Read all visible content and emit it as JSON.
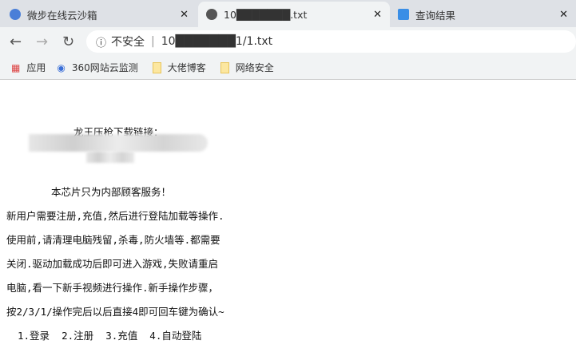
{
  "tabs": [
    {
      "title": "微步在线云沙箱",
      "icon": "weibu-logo-icon"
    },
    {
      "title": "10███████.txt",
      "icon": "globe-icon",
      "active": true
    },
    {
      "title": "查询结果",
      "icon": "x-logo-icon"
    }
  ],
  "toolbar": {
    "security_label": "不安全",
    "url": "10███████1/1.txt"
  },
  "bookmarks": [
    {
      "label": "应用",
      "icon": "apps-grid-icon"
    },
    {
      "label": "360网站云监测",
      "icon": "360-logo-icon"
    },
    {
      "label": "大佬博客",
      "icon": "folder-icon"
    },
    {
      "label": "网络安全",
      "icon": "folder-icon"
    }
  ],
  "content": {
    "lines": [
      "龙王压枪下载链接：",
      "本芯片只为内部顾客服务！",
      "新用户需要注册,充值,然后进行登陆加载等操作.",
      "使用前,请清理电脑残留,杀毒,防火墙等.都需要",
      "关闭.驱动加载成功后即可进入游戏,失败请重启",
      "电脑,看一下新手视频进行操作.新手操作步骤，",
      "按2/3/1/操作完后以后直接4即可回车键为确认~",
      "1.登录  2.注册  3.充值  4.自动登陆"
    ]
  }
}
